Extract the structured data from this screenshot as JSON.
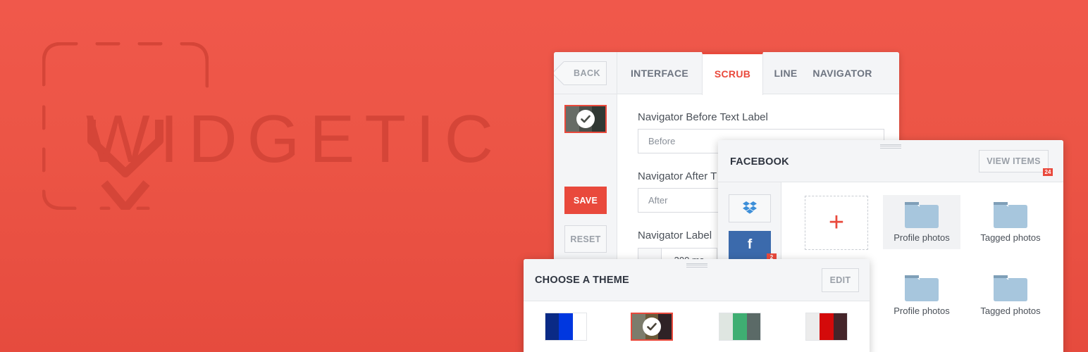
{
  "brand": {
    "logo_text": "WIDGETIC"
  },
  "colors": {
    "background": "#ec5546",
    "accent": "#e9493c",
    "facebook_blue": "#3b6aac",
    "dropbox_blue": "#3d8fd9",
    "folder_blue": "#a7c6dd"
  },
  "main_panel": {
    "back_label": "BACK",
    "tabs": [
      {
        "label": "INTERFACE",
        "active": false
      },
      {
        "label": "SCRUB",
        "active": true
      },
      {
        "label": "LINE",
        "active": false
      },
      {
        "label": "NAVIGATOR",
        "active": false
      }
    ],
    "selected_theme_colors": [
      "#676c66",
      "#4b4f4a",
      "#303833"
    ],
    "save_label": "SAVE",
    "reset_label": "RESET",
    "fields": [
      {
        "label": "Navigator Before Text Label",
        "value": "Before"
      },
      {
        "label": "Navigator After T",
        "value": "After"
      },
      {
        "label": "Navigator Label",
        "value": "300 ms"
      }
    ]
  },
  "facebook_panel": {
    "title": "FACEBOOK",
    "view_items_label": "VIEW ITEMS",
    "view_items_count": "24",
    "sources": [
      {
        "name": "dropbox",
        "icon": "dropbox-icon"
      },
      {
        "name": "facebook",
        "icon": "facebook-icon",
        "glyph": "f",
        "badge": "2"
      }
    ],
    "add_glyph": "+",
    "folders": [
      {
        "label": "Profile photos",
        "highlighted": true
      },
      {
        "label": "Tagged photos",
        "highlighted": false
      },
      {
        "label": "Profile photos",
        "highlighted": false
      },
      {
        "label": "Tagged photos",
        "highlighted": false
      }
    ]
  },
  "theme_panel": {
    "title": "CHOOSE A THEME",
    "edit_label": "EDIT",
    "themes": [
      {
        "colors": [
          "#0a2a86",
          "#0037e0",
          "#ffffff"
        ],
        "selected": false
      },
      {
        "colors": [
          "#7c7c6c",
          "#6a5a3a",
          "#2f2226"
        ],
        "selected": true
      },
      {
        "colors": [
          "#dfe6e1",
          "#3fae72",
          "#5b6a67"
        ],
        "selected": false
      },
      {
        "colors": [
          "#ececec",
          "#d40a0a",
          "#45252a"
        ],
        "selected": false
      }
    ]
  }
}
